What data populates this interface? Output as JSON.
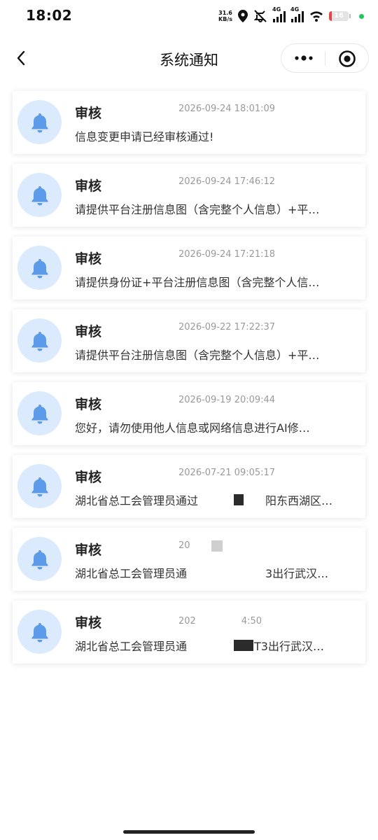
{
  "status_bar": {
    "time": "18:02",
    "net_speed_value": "31.6",
    "net_speed_unit": "KB/s",
    "sim1_label": "4G",
    "sim2_label": "4G",
    "battery": "16",
    "battery_level": 0.16
  },
  "header": {
    "title": "系统通知"
  },
  "colors": {
    "bell": "#5b9bea",
    "avatar_bg": "#dbeafc",
    "battery_low": "#e0454a"
  },
  "notifications": [
    {
      "title": "审核",
      "time": "2026-09-24 18:01:09",
      "message": "信息变更申请已经审核通过!"
    },
    {
      "title": "审核",
      "time": "2026-09-24 17:46:12",
      "message": "请提供平台注册信息图（含完整个人信息）+平…"
    },
    {
      "title": "审核",
      "time": "2026-09-24 17:21:18",
      "message": "请提供身份证+平台注册信息图（含完整个人信…"
    },
    {
      "title": "审核",
      "time": "2026-09-22 17:22:37",
      "message": "请提供平台注册信息图（含完整个人信息）+平…"
    },
    {
      "title": "审核",
      "time": "2026-09-19 20:09:44",
      "message": "您好，请勿使用他人信息或网络信息进行AI修…"
    },
    {
      "title": "审核",
      "time": "2026-07-21 09:05:17",
      "message": "湖北省总工会管理员通过　　　　　　阳东西湖区吴…"
    },
    {
      "title": "审核",
      "time": "20",
      "message": "湖北省总工会管理员通　　　　　　　3出行武汉…"
    },
    {
      "title": "审核",
      "time": "202　　　　　4:50",
      "message": "湖北省总工会管理员通　　　　　　T3出行武汉…"
    }
  ]
}
